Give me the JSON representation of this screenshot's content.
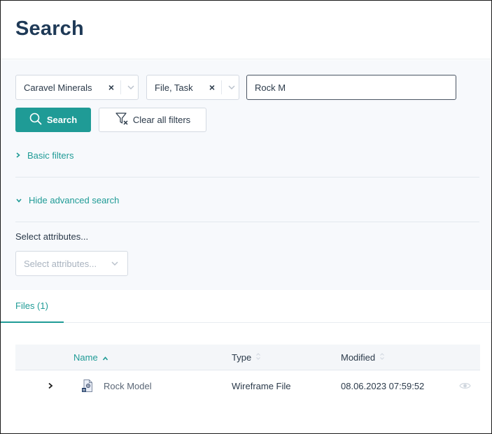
{
  "page": {
    "title": "Search"
  },
  "filters": {
    "company": {
      "value": "Caravel Minerals",
      "clear": "×"
    },
    "types": {
      "value": "File, Task",
      "clear": "×"
    },
    "query": {
      "value": "Rock M"
    },
    "search_label": "Search",
    "clear_all_label": "Clear all filters",
    "basic_filters_label": "Basic filters",
    "hide_advanced_label": "Hide advanced search",
    "attributes_label": "Select attributes...",
    "attributes_placeholder": "Select attributes..."
  },
  "tabs": [
    {
      "label": "Files (1)",
      "active": true
    }
  ],
  "table": {
    "columns": [
      {
        "label": "Name",
        "sort": "asc"
      },
      {
        "label": "Type",
        "sort": "none"
      },
      {
        "label": "Modified",
        "sort": "none"
      }
    ],
    "rows": [
      {
        "name": "Rock Model",
        "type": "Wireframe File",
        "modified": "08.06.2023 07:59:52"
      }
    ]
  },
  "colors": {
    "accent": "#1f9b96",
    "title": "#1f3a57",
    "panel_bg": "#f7f9fc"
  },
  "icons": {
    "search": "search-icon",
    "clear_filter": "filter-clear-icon",
    "chevron_right": "chevron-right-icon",
    "chevron_down": "chevron-down-icon",
    "sort_up": "sort-asc-icon",
    "sort_both": "sort-both-icon",
    "file": "wireframe-file-icon",
    "eye": "eye-icon"
  }
}
